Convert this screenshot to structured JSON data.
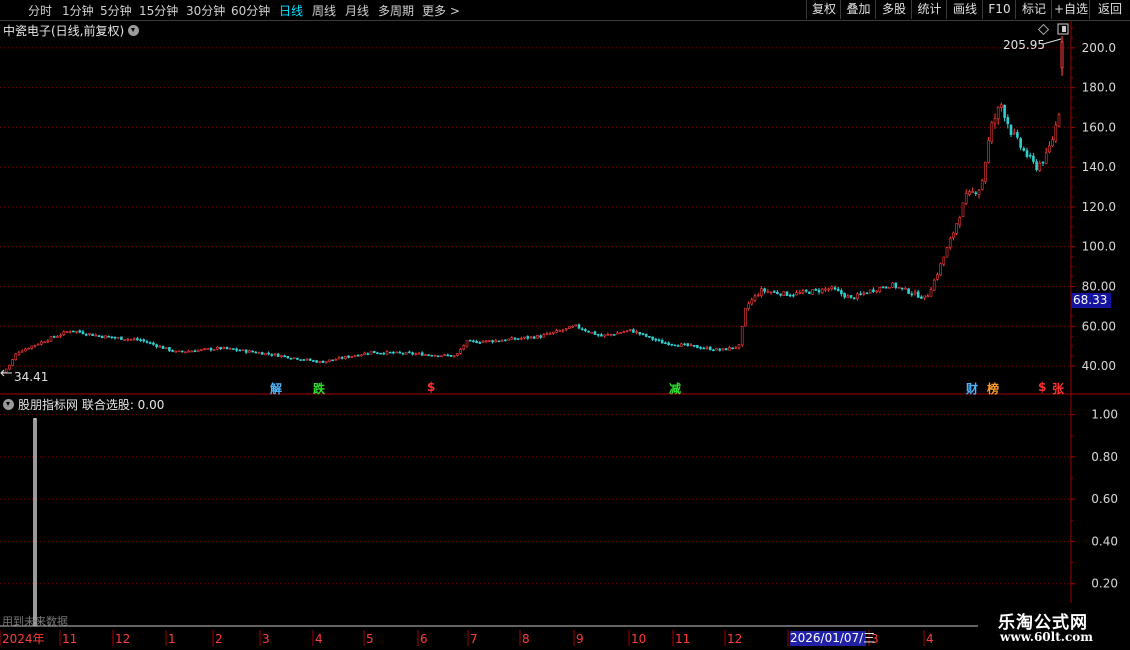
{
  "toolbar": {
    "timeframes": [
      {
        "label": "分时",
        "active": false
      },
      {
        "label": "1分钟",
        "active": false
      },
      {
        "label": "5分钟",
        "active": false
      },
      {
        "label": "15分钟",
        "active": false
      },
      {
        "label": "30分钟",
        "active": false
      },
      {
        "label": "60分钟",
        "active": false
      },
      {
        "label": "日线",
        "active": true
      },
      {
        "label": "周线",
        "active": false
      },
      {
        "label": "月线",
        "active": false
      },
      {
        "label": "多周期",
        "active": false
      },
      {
        "label": "更多 >",
        "active": false
      }
    ],
    "buttons": [
      "复权",
      "叠加",
      "多股",
      "统计",
      "画线",
      "F10",
      "标记",
      "+自选",
      "返回"
    ]
  },
  "main_title": "中瓷电子(日线,前复权)",
  "price_max_label": "205.95",
  "price_min_label": "34.41",
  "current_price": "68.33",
  "event_markers": [
    {
      "text": "解",
      "color": "#4fb5ff"
    },
    {
      "text": "跌",
      "color": "#2ee02e"
    },
    {
      "text": "$",
      "color": "#ff3030"
    },
    {
      "text": "减",
      "color": "#2ee02e"
    },
    {
      "text": "财",
      "color": "#4fb5ff"
    },
    {
      "text": "榜",
      "color": "#ff9a2a"
    },
    {
      "text": "$",
      "color": "#ff3030"
    },
    {
      "text": "张",
      "color": "#ff3030"
    }
  ],
  "sub_title": "股朋指标网  联合选股: 0.00",
  "future_note": "用到未来数据",
  "date_cursor": "2026/01/07/三",
  "watermark": {
    "line1": "乐淘公式网",
    "line2": "www.60lt.com"
  },
  "colors": {
    "up": "#ff3b3b",
    "down": "#30d0d0",
    "grid": "#7a0000",
    "axis": "#a00000",
    "accent": "#00e0ff"
  },
  "chart_data": [
    {
      "type": "candlestick",
      "title": "中瓷电子(日线,前复权)",
      "y_ticks": [
        "200.0",
        "180.0",
        "160.0",
        "140.0",
        "120.0",
        "100.0",
        "80.00",
        "60.00",
        "40.00"
      ],
      "ylim": [
        33,
        212
      ],
      "max_label": 205.95,
      "min_label": 34.41,
      "last_close": 68.33,
      "close_path": [
        [
          0,
          36
        ],
        [
          8,
          40
        ],
        [
          16,
          47
        ],
        [
          40,
          52
        ],
        [
          70,
          58
        ],
        [
          100,
          55
        ],
        [
          140,
          53
        ],
        [
          175,
          47
        ],
        [
          220,
          49
        ],
        [
          270,
          46
        ],
        [
          320,
          42
        ],
        [
          370,
          47
        ],
        [
          420,
          46
        ],
        [
          455,
          45
        ],
        [
          465,
          52
        ],
        [
          500,
          53
        ],
        [
          540,
          55
        ],
        [
          575,
          60
        ],
        [
          600,
          55
        ],
        [
          630,
          58
        ],
        [
          660,
          52
        ],
        [
          690,
          50
        ],
        [
          720,
          48
        ],
        [
          738,
          50
        ],
        [
          745,
          70
        ],
        [
          760,
          78
        ],
        [
          790,
          76
        ],
        [
          830,
          79
        ],
        [
          850,
          74
        ],
        [
          870,
          78
        ],
        [
          890,
          81
        ],
        [
          910,
          77
        ],
        [
          925,
          74
        ],
        [
          935,
          85
        ],
        [
          950,
          104
        ],
        [
          965,
          125
        ],
        [
          980,
          130
        ],
        [
          990,
          160
        ],
        [
          1000,
          172
        ],
        [
          1010,
          158
        ],
        [
          1020,
          150
        ],
        [
          1035,
          140
        ],
        [
          1045,
          145
        ],
        [
          1052,
          155
        ],
        [
          1058,
          168
        ],
        [
          1062,
          205
        ]
      ]
    },
    {
      "type": "line",
      "title": "联合选股",
      "y_ticks": [
        "1.00",
        "0.80",
        "0.60",
        "0.40",
        "0.20"
      ],
      "ylim": [
        0,
        1.05
      ],
      "values_note_points": [
        [
          34,
          0
        ],
        [
          34,
          0.98
        ],
        [
          36,
          0.98
        ],
        [
          36,
          0
        ]
      ]
    }
  ],
  "time_axis": [
    "2024年",
    "11",
    "12",
    "1",
    "2",
    "3",
    "4",
    "5",
    "6",
    "7",
    "8",
    "9",
    "10",
    "11",
    "12",
    "1",
    "3",
    "4"
  ]
}
